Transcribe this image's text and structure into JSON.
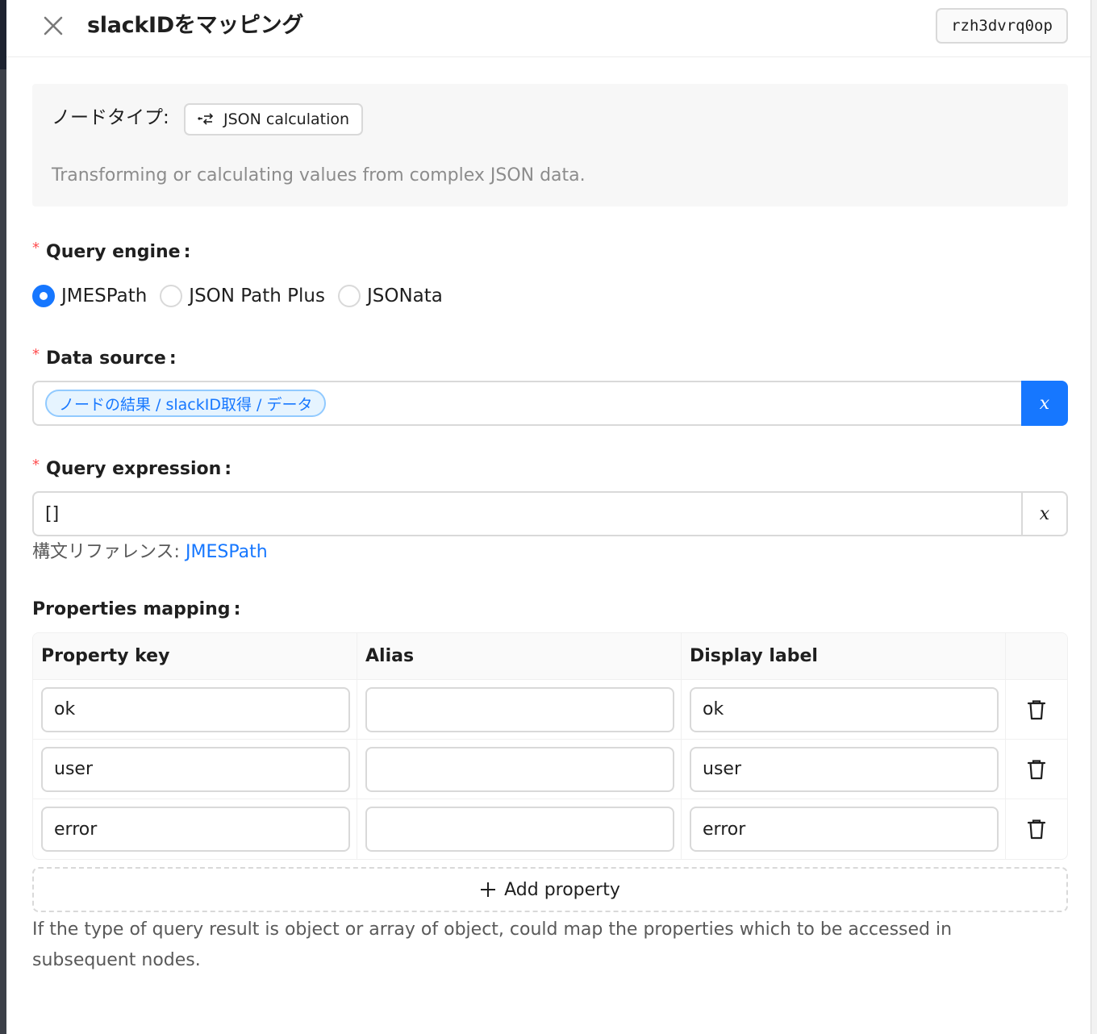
{
  "header": {
    "title": "slackIDをマッピング",
    "node_id": "rzh3dvrq0op"
  },
  "node_info": {
    "type_label": "ノードタイプ:",
    "type_value": "JSON calculation",
    "description": "Transforming or calculating values from complex JSON data."
  },
  "query_engine": {
    "label": "Query engine",
    "options": [
      "JMESPath",
      "JSON Path Plus",
      "JSONata"
    ],
    "selected": "JMESPath"
  },
  "data_source": {
    "label": "Data source",
    "value": "ノードの結果 / slackID取得 / データ",
    "variable_button": "x"
  },
  "query_expression": {
    "label": "Query expression",
    "value": "[]",
    "variable_button": "x",
    "reference_prefix": "構文リファレンス:",
    "reference_link": "JMESPath"
  },
  "properties_mapping": {
    "label": "Properties mapping",
    "columns": [
      "Property key",
      "Alias",
      "Display label"
    ],
    "rows": [
      {
        "key": "ok",
        "alias": "",
        "label": "ok"
      },
      {
        "key": "user",
        "alias": "",
        "label": "user"
      },
      {
        "key": "error",
        "alias": "",
        "label": "error"
      }
    ],
    "add_label": "Add property",
    "help": "If the type of query result is object or array of object, could map the properties which to be accessed in subsequent nodes."
  },
  "colors": {
    "primary": "#1677ff",
    "required": "#ff4d4f"
  }
}
